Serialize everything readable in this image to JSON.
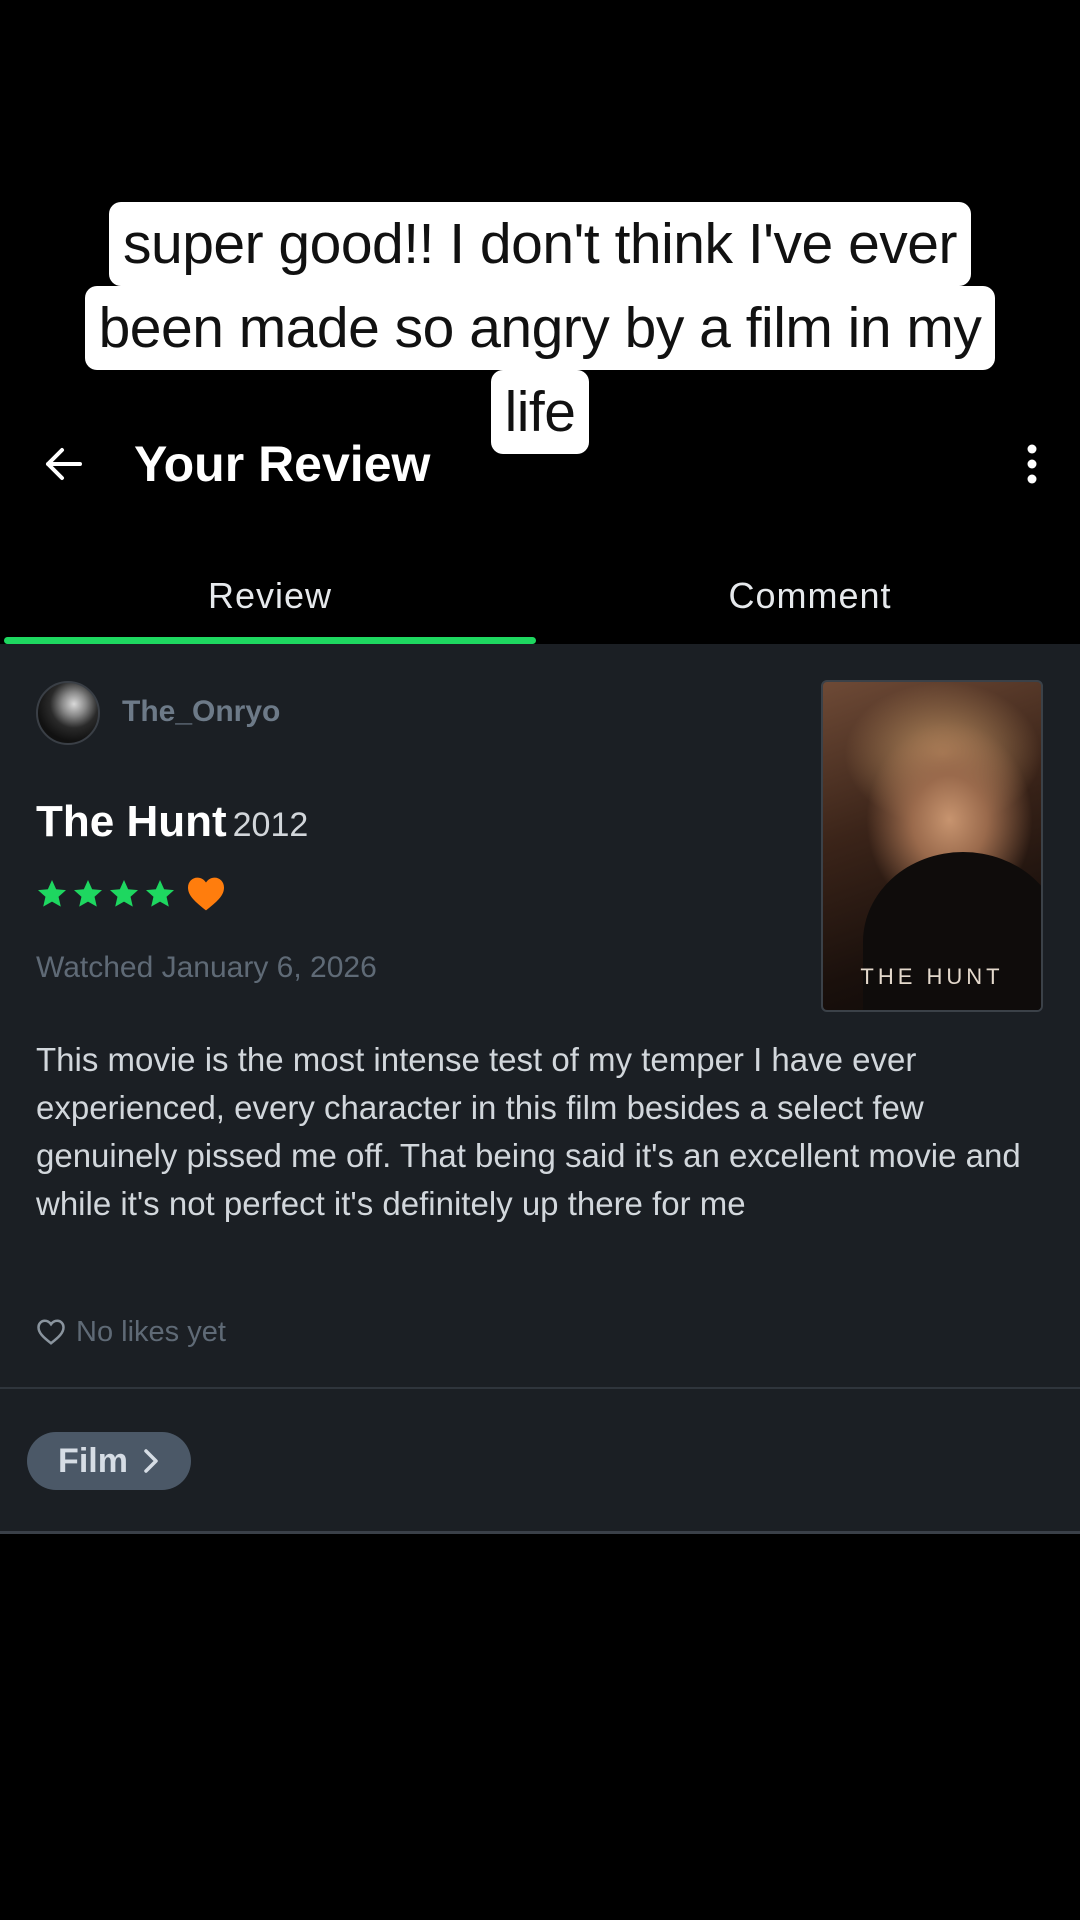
{
  "caption": {
    "lines": [
      "super good!! I don't think I've ever",
      "been made so angry by a film in my",
      "life"
    ]
  },
  "header": {
    "title": "Your Review",
    "back_icon": "arrow-left-icon",
    "more_icon": "more-vertical-icon"
  },
  "tabs": [
    {
      "label": "Review",
      "active": true
    },
    {
      "label": "Comment",
      "active": false
    }
  ],
  "review": {
    "username": "The_Onryo",
    "film_title": "The Hunt",
    "film_year": "2012",
    "rating_stars": 4,
    "rating_max": 5,
    "liked": true,
    "watched_text": "Watched January 6, 2026",
    "poster_title": "THE HUNT",
    "body": "This movie is the most intense test of my temper I have ever experienced, every character in this film besides a select few genuinely pissed me off. That being said it's an excellent movie and while it's not perfect it's definitely up there for me",
    "likes_text": "No likes yet"
  },
  "chip": {
    "label": "Film"
  },
  "colors": {
    "accent_green": "#1ed760",
    "heart_orange": "#ff7d0d",
    "card_bg": "#1b1f24",
    "chip_bg": "#4b5867"
  }
}
